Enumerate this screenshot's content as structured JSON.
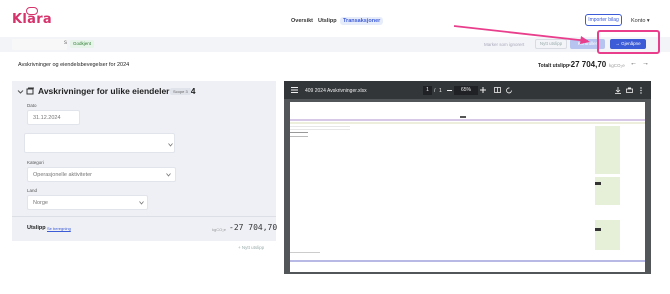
{
  "logo": "Klara",
  "nav": {
    "items": [
      "Oversikt",
      "Utslipp",
      "Transaksjoner"
    ],
    "import_label": "Importer bilag",
    "account_label": "Konto",
    "account_chevron": "▾"
  },
  "status": {
    "badge": "Godkjent",
    "doc_suffix": "s",
    "mark_label": "Marker som ignorert",
    "new_label": "Nytt utslipp",
    "kont_label": "Kontroller",
    "open_label": "Gjenåpne",
    "open_icon": "→"
  },
  "header": {
    "subtitle": "Avskrivninger og eiendelsbevegelser for 2024",
    "total_label": "Totalt utslipp",
    "total_value": "-27 704,70",
    "total_unit": "kgCO₂e",
    "prev_arrow": "←",
    "next_arrow": "→"
  },
  "form": {
    "title": "Avskrivninger for ulike eiendeler i 2024",
    "scope": "Scope 3",
    "date_label": "Dato",
    "date_value": "31.12.2024",
    "category_label": "Kategori",
    "category_value": "Operasjonelle aktiviteter",
    "country_label": "Land",
    "country_value": "Norge",
    "emission_label": "Utslipp",
    "calc_link": "Se beregning",
    "emission_unit": "kgCO₂e",
    "emission_value": "-27 704,70",
    "new_emission": "+ Nytt utslipp"
  },
  "pdf": {
    "filename": "409 2024 Avskrivninger.xlsx",
    "page_current": "1",
    "page_sep": "/",
    "page_total": "1",
    "zoom": "65%"
  },
  "colors": {
    "brand": "#d6336c",
    "accent": "#3c5bd6",
    "annotation": "#e83e8c"
  },
  "icons": [
    "chevron-down-icon",
    "assets-icon",
    "menu-icon",
    "download-icon",
    "print-icon",
    "more-icon",
    "fit-page-icon",
    "rotate-icon"
  ]
}
